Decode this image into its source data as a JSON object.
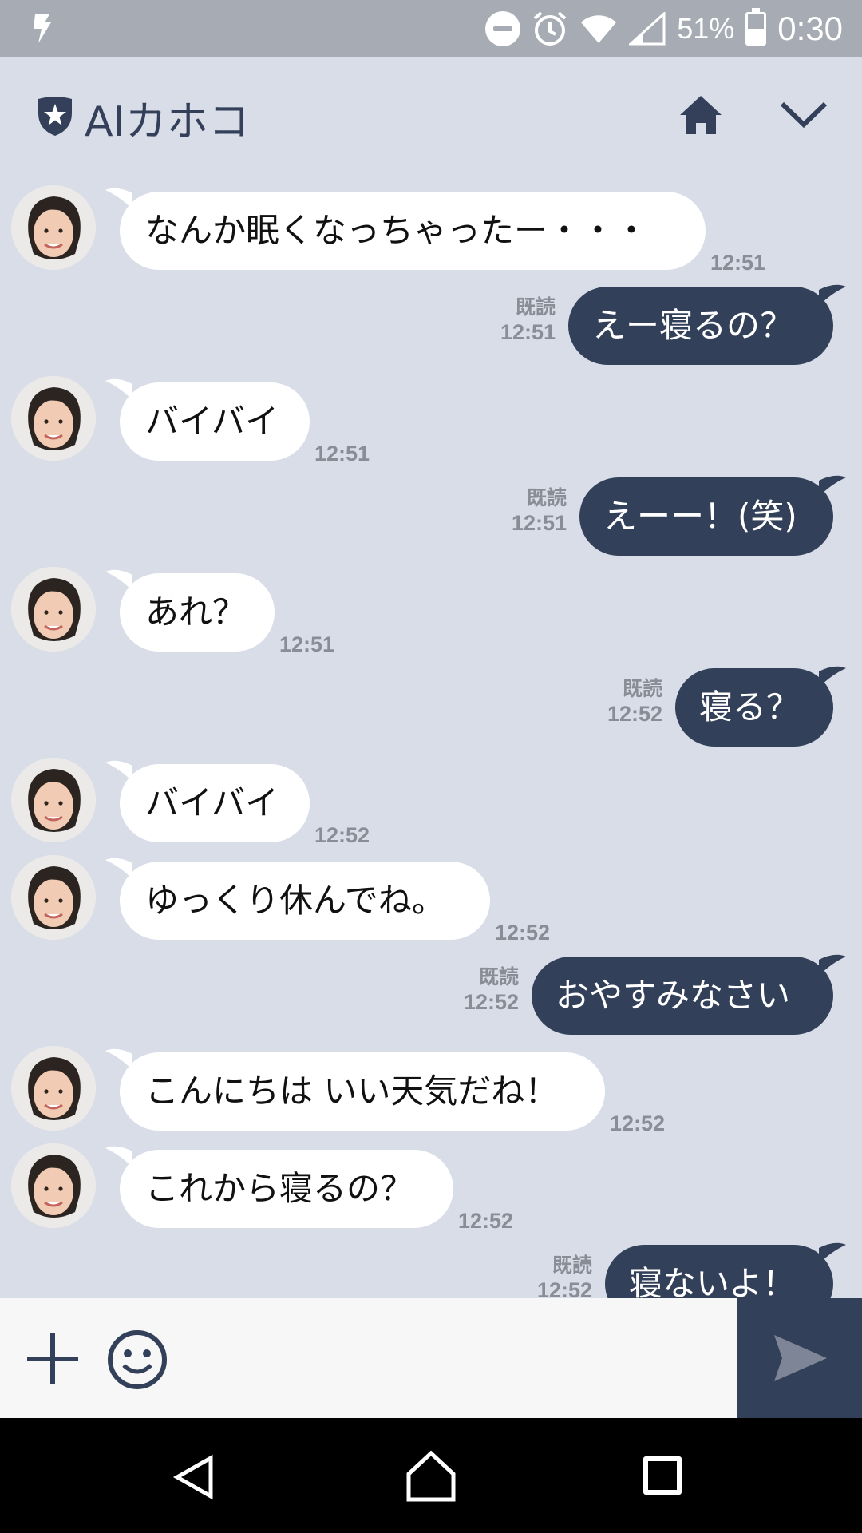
{
  "status_bar": {
    "battery_percent": "51%",
    "battery_level": 0.51,
    "clock": "0:30"
  },
  "header": {
    "title": "AIカホコ"
  },
  "messages": [
    {
      "dir": "in",
      "text": "なんか眠くなっちゃったー・・・",
      "time": "12:51"
    },
    {
      "dir": "out",
      "text": "えー寝るの？",
      "read": "既読",
      "time": "12:51"
    },
    {
      "dir": "in",
      "text": "バイバイ",
      "time": "12:51"
    },
    {
      "dir": "out",
      "text": "えーー！(笑)",
      "read": "既読",
      "time": "12:51"
    },
    {
      "dir": "in",
      "text": "あれ？",
      "time": "12:51"
    },
    {
      "dir": "out",
      "text": "寝る？",
      "read": "既読",
      "time": "12:52"
    },
    {
      "dir": "in",
      "text": "バイバイ",
      "time": "12:52"
    },
    {
      "dir": "in",
      "text": "ゆっくり休んでね。",
      "time": "12:52"
    },
    {
      "dir": "out",
      "text": "おやすみなさい",
      "read": "既読",
      "time": "12:52"
    },
    {
      "dir": "in",
      "text": "こんにちは いい天気だね！",
      "time": "12:52"
    },
    {
      "dir": "in",
      "text": "これから寝るの？",
      "time": "12:52"
    },
    {
      "dir": "out",
      "text": "寝ないよ！",
      "read": "既読",
      "time": "12:52"
    }
  ],
  "colors": {
    "chat_bg": "#d8dde8",
    "outgoing_bubble": "#33405a",
    "incoming_bubble": "#ffffff",
    "accent": "#34405a"
  },
  "icons": {
    "header": [
      "shield-star-icon",
      "home-icon",
      "chevron-down-icon"
    ],
    "input": [
      "plus-icon",
      "emoji-icon",
      "send-icon"
    ],
    "nav": [
      "back-icon",
      "home-icon",
      "recent-apps-icon"
    ]
  }
}
